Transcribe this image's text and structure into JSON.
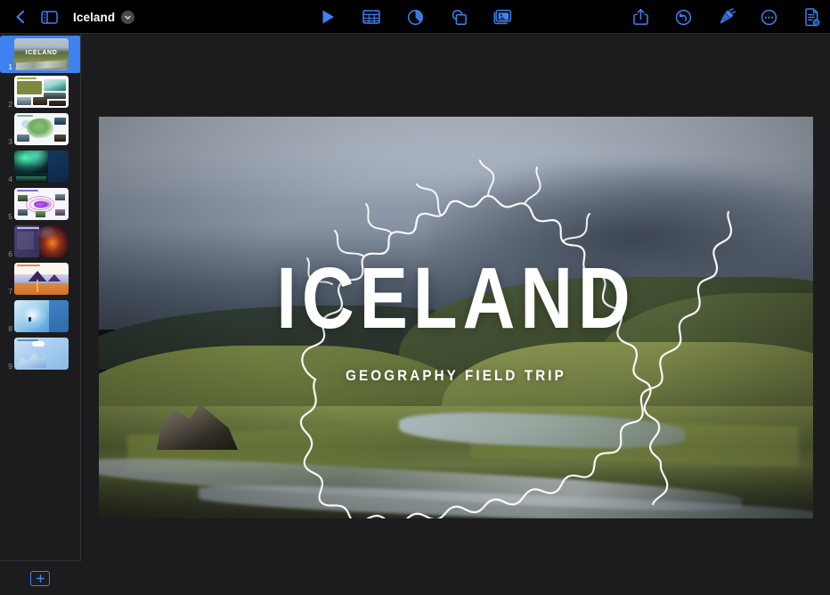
{
  "app": {
    "name": "Keynote",
    "accent_color": "#3f81ee",
    "toolbar_bg": "#000000",
    "canvas_bg": "#1c1c1e"
  },
  "toolbar": {
    "back_label": "Back",
    "back_icon": "chevron-left-icon",
    "sidebar_toggle_icon": "sidebar-panel-icon",
    "document_title": "Iceland",
    "title_menu_icon": "chevron-down-icon",
    "center_buttons": [
      {
        "name": "play",
        "label": "Play",
        "icon": "play-triangle-icon"
      },
      {
        "name": "table",
        "label": "Table",
        "icon": "table-grid-icon"
      },
      {
        "name": "chart",
        "label": "Chart",
        "icon": "pie-chart-icon"
      },
      {
        "name": "shape",
        "label": "Shape",
        "icon": "shapes-overlap-icon"
      },
      {
        "name": "media",
        "label": "Media",
        "icon": "photo-stack-icon"
      }
    ],
    "right_buttons": [
      {
        "name": "share",
        "label": "Share",
        "icon": "share-up-arrow-icon"
      },
      {
        "name": "undo",
        "label": "Undo",
        "icon": "undo-arrow-icon"
      },
      {
        "name": "format",
        "label": "Format",
        "icon": "paintbrush-icon"
      },
      {
        "name": "more",
        "label": "More",
        "icon": "ellipsis-circle-icon"
      },
      {
        "name": "document-options",
        "label": "Document Options",
        "icon": "document-icon"
      }
    ]
  },
  "sidebar": {
    "add_slide_label": "+",
    "add_slide_icon": "plus-icon",
    "slides": [
      {
        "number": "1",
        "name": "title-hero",
        "title": "ICELAND",
        "selected": true
      },
      {
        "number": "2",
        "name": "intro-photos",
        "selected": false
      },
      {
        "number": "3",
        "name": "map-regions",
        "selected": false
      },
      {
        "number": "4",
        "name": "aurora-borealis",
        "selected": false
      },
      {
        "number": "5",
        "name": "diagram-purple",
        "selected": false
      },
      {
        "number": "6",
        "name": "volcano-eruption",
        "selected": false
      },
      {
        "number": "7",
        "name": "volcano-diagram",
        "selected": false
      },
      {
        "number": "8",
        "name": "ice-cave",
        "selected": false
      },
      {
        "number": "9",
        "name": "iceberg-map",
        "selected": false
      }
    ]
  },
  "slide": {
    "name": "slide-1-title",
    "title": "ICELAND",
    "subtitle": "GEOGRAPHY FIELD TRIP",
    "background_image_alt": "Icelandic highland valley with green mossy hills, braided glacial river and storm clouds",
    "overlay_graphic": "iceland-map-outline",
    "text_color": "#ffffff"
  }
}
